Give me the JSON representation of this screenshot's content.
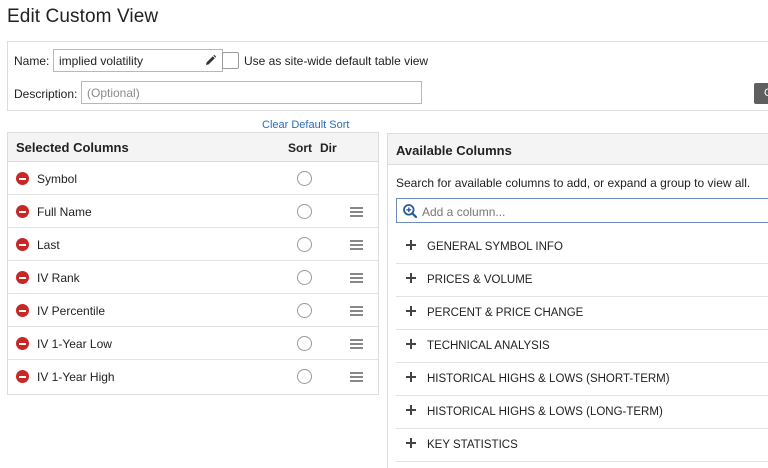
{
  "page": {
    "title": "Edit Custom View"
  },
  "settings": {
    "name_label": "Name:",
    "name_value": "implied volatility",
    "default_checkbox_label": "Use as site-wide default table view",
    "description_label": "Description:",
    "description_placeholder": "(Optional)",
    "button_label": "C"
  },
  "clear_sort_label": "Clear Default Sort",
  "selected_columns": {
    "title": "Selected Columns",
    "sort_header": "Sort",
    "dir_header": "Dir",
    "rows": [
      {
        "label": "Symbol",
        "draggable": false
      },
      {
        "label": "Full Name",
        "draggable": true
      },
      {
        "label": "Last",
        "draggable": true
      },
      {
        "label": "IV Rank",
        "draggable": true
      },
      {
        "label": "IV Percentile",
        "draggable": true
      },
      {
        "label": "IV 1-Year Low",
        "draggable": true
      },
      {
        "label": "IV 1-Year High",
        "draggable": true
      }
    ]
  },
  "available_columns": {
    "title": "Available Columns",
    "hint": "Search for available columns to add, or expand a group to view all.",
    "search_placeholder": "Add a column...",
    "groups": [
      "GENERAL SYMBOL INFO",
      "PRICES & VOLUME",
      "PERCENT & PRICE CHANGE",
      "TECHNICAL ANALYSIS",
      "HISTORICAL HIGHS & LOWS (SHORT-TERM)",
      "HISTORICAL HIGHS & LOWS (LONG-TERM)",
      "KEY STATISTICS"
    ]
  },
  "colors": {
    "remove": "#c62828",
    "link": "#2a6bb5",
    "button_bg": "#5f5f5f"
  }
}
